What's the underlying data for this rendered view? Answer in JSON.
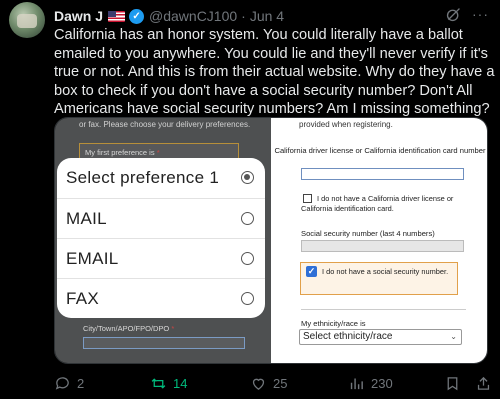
{
  "author": {
    "name": "Dawn J",
    "handle": "@dawnCJ100",
    "separator": "·",
    "date": "Jun 4"
  },
  "tweet": {
    "text": "California has an honor system. You could literally have a ballot emailed to you anywhere. You could lie and they'll never verify if it's true or not. And this is from their actual website. Why do they have a box to check if you don't have a social security number? Don't All Americans have social security numbers? Am I missing something?"
  },
  "left_screenshot": {
    "top_text": "or fax. Please choose your delivery preferences.",
    "pref_label": "My first preference is",
    "required_mark": "*",
    "picker": {
      "title": "Select preference 1",
      "options": [
        "MAIL",
        "EMAIL",
        "FAX"
      ]
    },
    "city_label": "City/Town/APO/FPO/DPO"
  },
  "right_screenshot": {
    "top_text": "provided when registering.",
    "license_label": "California driver license or California identification card number",
    "no_license_label": "I do not have a California driver license or California identification card.",
    "ssn_label": "Social security number (last 4 numbers)",
    "no_ssn_label": "I do not have a social security number.",
    "ethnicity_label": "My ethnicity/race is",
    "ethnicity_select": "Select ethnicity/race"
  },
  "actions": {
    "replies": "2",
    "retweets": "14",
    "likes": "25",
    "views": "230"
  },
  "colors": {
    "verified": "#1d9bf0",
    "retweet": "#00ba7c",
    "muted": "#71767b",
    "highlight_border": "#e1a04a"
  }
}
